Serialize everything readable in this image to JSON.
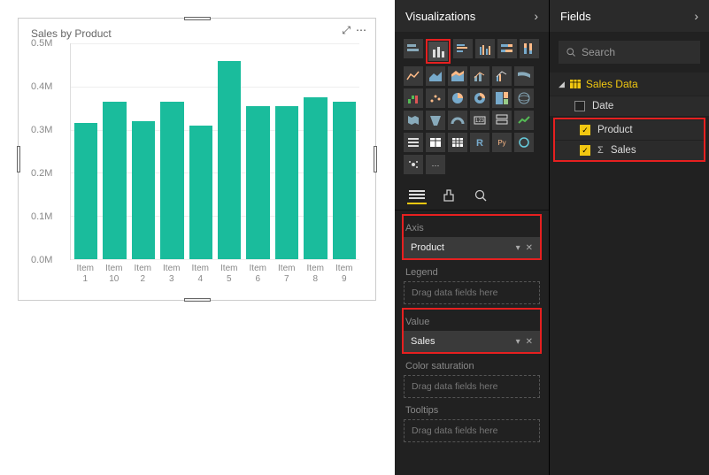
{
  "chart_data": {
    "type": "bar",
    "title": "Sales by Product",
    "categories": [
      "Item 1",
      "Item 10",
      "Item 2",
      "Item 3",
      "Item 4",
      "Item 5",
      "Item 6",
      "Item 7",
      "Item 8",
      "Item 9"
    ],
    "values": [
      315000,
      365000,
      320000,
      365000,
      310000,
      460000,
      355000,
      355000,
      375000,
      365000
    ],
    "ylabel": "",
    "xlabel": "",
    "ylim": [
      0,
      500000
    ],
    "y_ticks": [
      "0.5M",
      "0.4M",
      "0.3M",
      "0.2M",
      "0.1M",
      "0.0M"
    ]
  },
  "chart_actions": {
    "focus": "⤢",
    "more": "⋯"
  },
  "viz_panel": {
    "title": "Visualizations",
    "tabs": {
      "fields": "fields",
      "format": "format",
      "analytics": "analytics"
    },
    "wells": {
      "axis": {
        "label": "Axis",
        "value": "Product"
      },
      "legend": {
        "label": "Legend",
        "placeholder": "Drag data fields here"
      },
      "value": {
        "label": "Value",
        "value": "Sales"
      },
      "color": {
        "label": "Color saturation",
        "placeholder": "Drag data fields here"
      },
      "tooltips": {
        "label": "Tooltips",
        "placeholder": "Drag data fields here"
      }
    }
  },
  "fields_panel": {
    "title": "Fields",
    "search_placeholder": "Search",
    "table": "Sales Data",
    "fields": [
      {
        "name": "Date",
        "checked": false,
        "agg": false
      },
      {
        "name": "Product",
        "checked": true,
        "agg": false
      },
      {
        "name": "Sales",
        "checked": true,
        "agg": true
      }
    ]
  }
}
